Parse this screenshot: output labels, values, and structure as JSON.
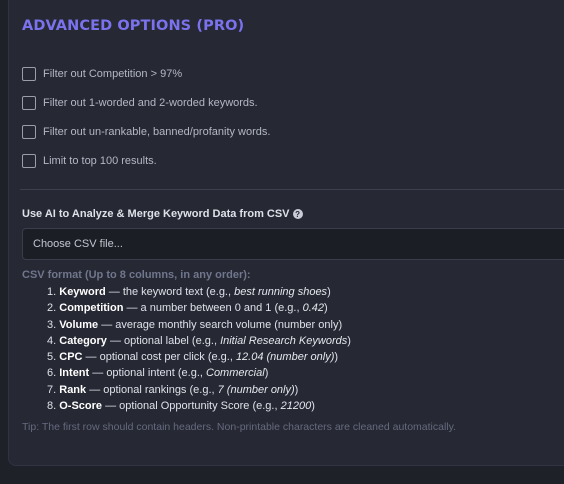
{
  "section": {
    "title": "ADVANCED OPTIONS (PRO)"
  },
  "options": [
    {
      "label": "Filter out Competition > 97%",
      "checked": false
    },
    {
      "label": "Filter out 1-worded and 2-worded keywords.",
      "checked": false
    },
    {
      "label": "Filter out un-rankable, banned/profanity words.",
      "checked": false
    },
    {
      "label": "Limit to top 100 results.",
      "checked": false
    }
  ],
  "ai": {
    "label": "Use AI to Analyze & Merge Keyword Data from CSV",
    "help_icon": "question-circle-icon",
    "file_placeholder": "Choose CSV file..."
  },
  "csv_format": {
    "heading": "CSV format (Up to 8 columns, in any order):",
    "columns": [
      {
        "num": "1.",
        "name": "Keyword",
        "desc": " — the keyword text (e.g., ",
        "example": "best running shoes",
        "end": ")"
      },
      {
        "num": "2.",
        "name": "Competition",
        "desc": " — a number between 0 and 1 (e.g., ",
        "example": "0.42",
        "end": ")"
      },
      {
        "num": "3.",
        "name": "Volume",
        "desc": " — average monthly search volume (number only)",
        "example": "",
        "end": ""
      },
      {
        "num": "4.",
        "name": "Category",
        "desc": " — optional label (e.g., ",
        "example": "Initial Research Keywords",
        "end": ")"
      },
      {
        "num": "5.",
        "name": "CPC",
        "desc": " — optional cost per click (e.g., ",
        "example": "12.04 (number only)",
        "end": ")"
      },
      {
        "num": "6.",
        "name": "Intent",
        "desc": " — optional intent (e.g., ",
        "example": "Commercial",
        "end": ")"
      },
      {
        "num": "7.",
        "name": "Rank",
        "desc": " — optional rankings (e.g., ",
        "example": "7 (number only)",
        "end": ")"
      },
      {
        "num": "8.",
        "name": "O-Score",
        "desc": " — optional Opportunity Score (e.g., ",
        "example": "21200",
        "end": ")"
      }
    ]
  },
  "tip": "Tip: The first row should contain headers. Non-printable characters are cleaned automatically.",
  "colors": {
    "accent": "#7b72ee",
    "panel_bg": "#262834",
    "page_bg": "#1f2129"
  }
}
